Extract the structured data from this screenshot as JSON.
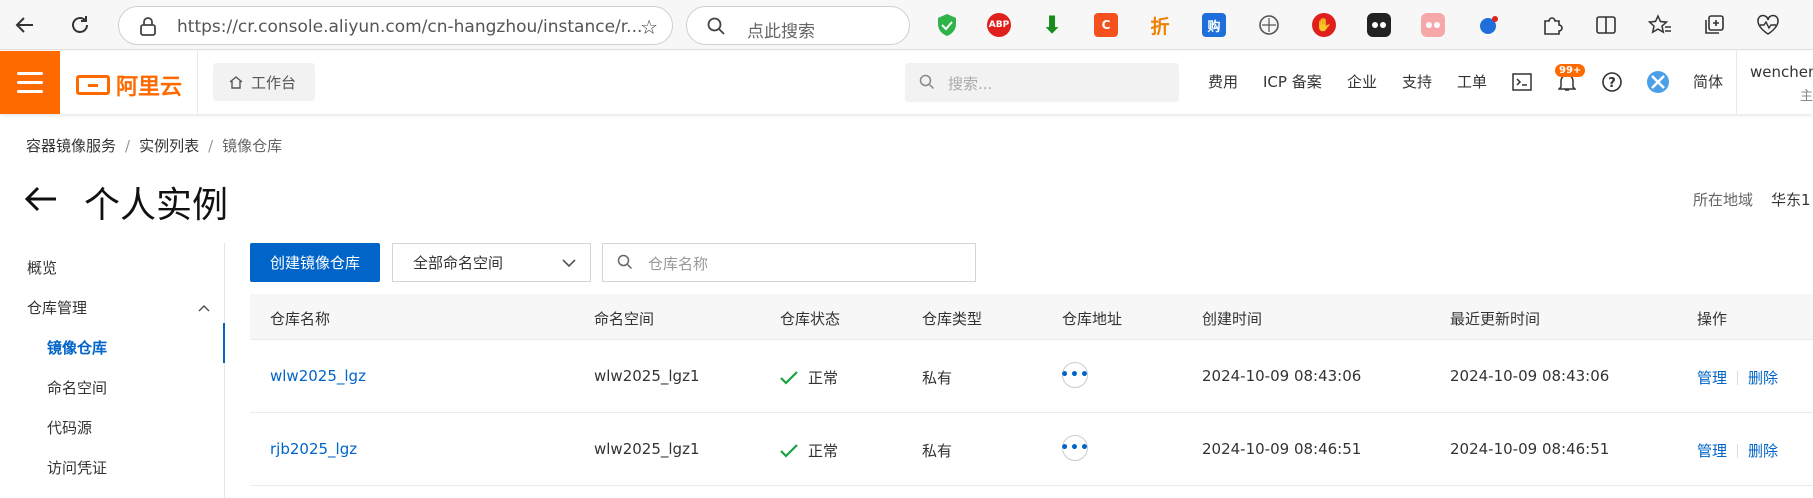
{
  "browser": {
    "url": "https://cr.console.aliyun.com/cn-hangzhou/instance/r...",
    "search_placeholder": "点此搜索",
    "extensions": [
      "shield-icon",
      "adblock-icon",
      "download-icon",
      "c-icon",
      "zhe-icon",
      "gou-icon",
      "compass-icon",
      "hand-icon",
      "media-icon",
      "record-icon",
      "translate-icon",
      "puzzle-icon",
      "split-icon",
      "favorites-icon",
      "collections-icon",
      "heartbeat-icon"
    ],
    "ext_labels": {
      "adblock": "ABP",
      "c": "C",
      "zhe": "折",
      "gou": "购"
    }
  },
  "topbar": {
    "logo_text": "阿里云",
    "workbench": "工作台",
    "search_placeholder": "搜索...",
    "links": [
      "费用",
      "ICP 备案",
      "企业",
      "支持",
      "工单"
    ],
    "notification_badge": "99+",
    "language": "简体",
    "user": "wenchen",
    "user_sub": "主"
  },
  "breadcrumb": [
    "容器镜像服务",
    "实例列表",
    "镜像仓库"
  ],
  "page_title": "个人实例",
  "region": {
    "label": "所在地域",
    "value": "华东1"
  },
  "sidebar": {
    "overview": "概览",
    "repo_mgmt": "仓库管理",
    "items": [
      "镜像仓库",
      "命名空间",
      "代码源",
      "访问凭证"
    ]
  },
  "toolbar": {
    "create_button": "创建镜像仓库",
    "namespace_select": "全部命名空间",
    "repo_search_placeholder": "仓库名称"
  },
  "table": {
    "headers": [
      "仓库名称",
      "命名空间",
      "仓库状态",
      "仓库类型",
      "仓库地址",
      "创建时间",
      "最近更新时间",
      "操作"
    ],
    "rows": [
      {
        "name": "wlw2025_lgz",
        "namespace": "wlw2025_lgz1",
        "status": "正常",
        "type": "私有",
        "created": "2024-10-09 08:43:06",
        "updated": "2024-10-09 08:43:06",
        "manage": "管理",
        "delete": "删除"
      },
      {
        "name": "rjb2025_lgz",
        "namespace": "wlw2025_lgz1",
        "status": "正常",
        "type": "私有",
        "created": "2024-10-09 08:46:51",
        "updated": "2024-10-09 08:46:51",
        "manage": "管理",
        "delete": "删除"
      }
    ]
  },
  "colors": {
    "brand": "#ff6a00",
    "primary": "#0064c8",
    "success": "#1aa340"
  }
}
